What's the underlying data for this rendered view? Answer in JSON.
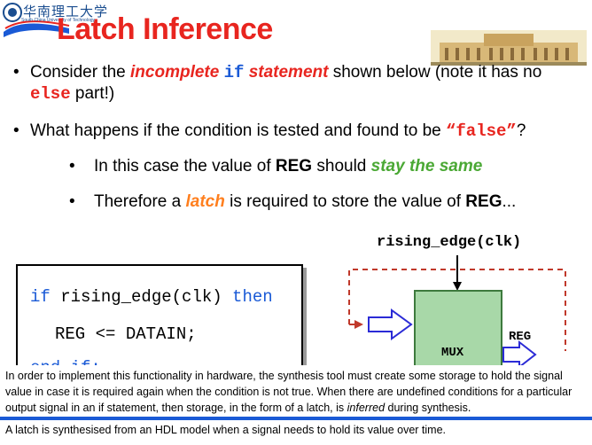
{
  "header": {
    "logo_text": "华南理工大学",
    "logo_subtext": "South China University of Technology",
    "title": "Latch Inference"
  },
  "bullets": {
    "b1": {
      "t1": "Consider the ",
      "t2": "incomplete",
      "t3": " ",
      "t4": "if",
      "t5": " ",
      "t6": "statement",
      "t7": " shown below  (note it has no",
      "t8": "else",
      "t9": " part!)"
    },
    "b2": {
      "t1": "What happens if the condition is tested and found to be ",
      "t2": "“false”",
      "t3": "?"
    },
    "b3": {
      "t1": "In this case the value of ",
      "t2": "REG",
      "t3": " should ",
      "t4": "stay the same"
    },
    "b4": {
      "t1": "Therefore a ",
      "t2": "latch",
      "t3": " is required to store the value of ",
      "t4": "REG",
      "t5": "..."
    }
  },
  "code": {
    "l1_kw1": "if",
    "l1_mid": " rising_edge(clk) ",
    "l1_kw2": "then",
    "l2": "REG <= DATAIN;",
    "l3_kw1": "end",
    "l3_kw2": "if;"
  },
  "diagram": {
    "clk_label": "rising_edge(clk)",
    "reg_label": "REG",
    "mux_label": "MUX",
    "colors": {
      "mux_fill": "#a8d8a8",
      "dashed": "#c0392b",
      "arrow": "#2b2bd6"
    }
  },
  "note": {
    "p1": "In order to implement this functionality in hardware, the synthesis tool must create some storage to hold the signal value in case it is required again when the condition is not true. When there are undefined conditions for a particular output signal in an if statement, then storage, in the form of a latch, is ",
    "p1_it": "inferred",
    "p1_end": " during synthesis."
  },
  "footer": {
    "text": "A latch is synthesised from an HDL model when a signal needs to hold its value over time."
  }
}
